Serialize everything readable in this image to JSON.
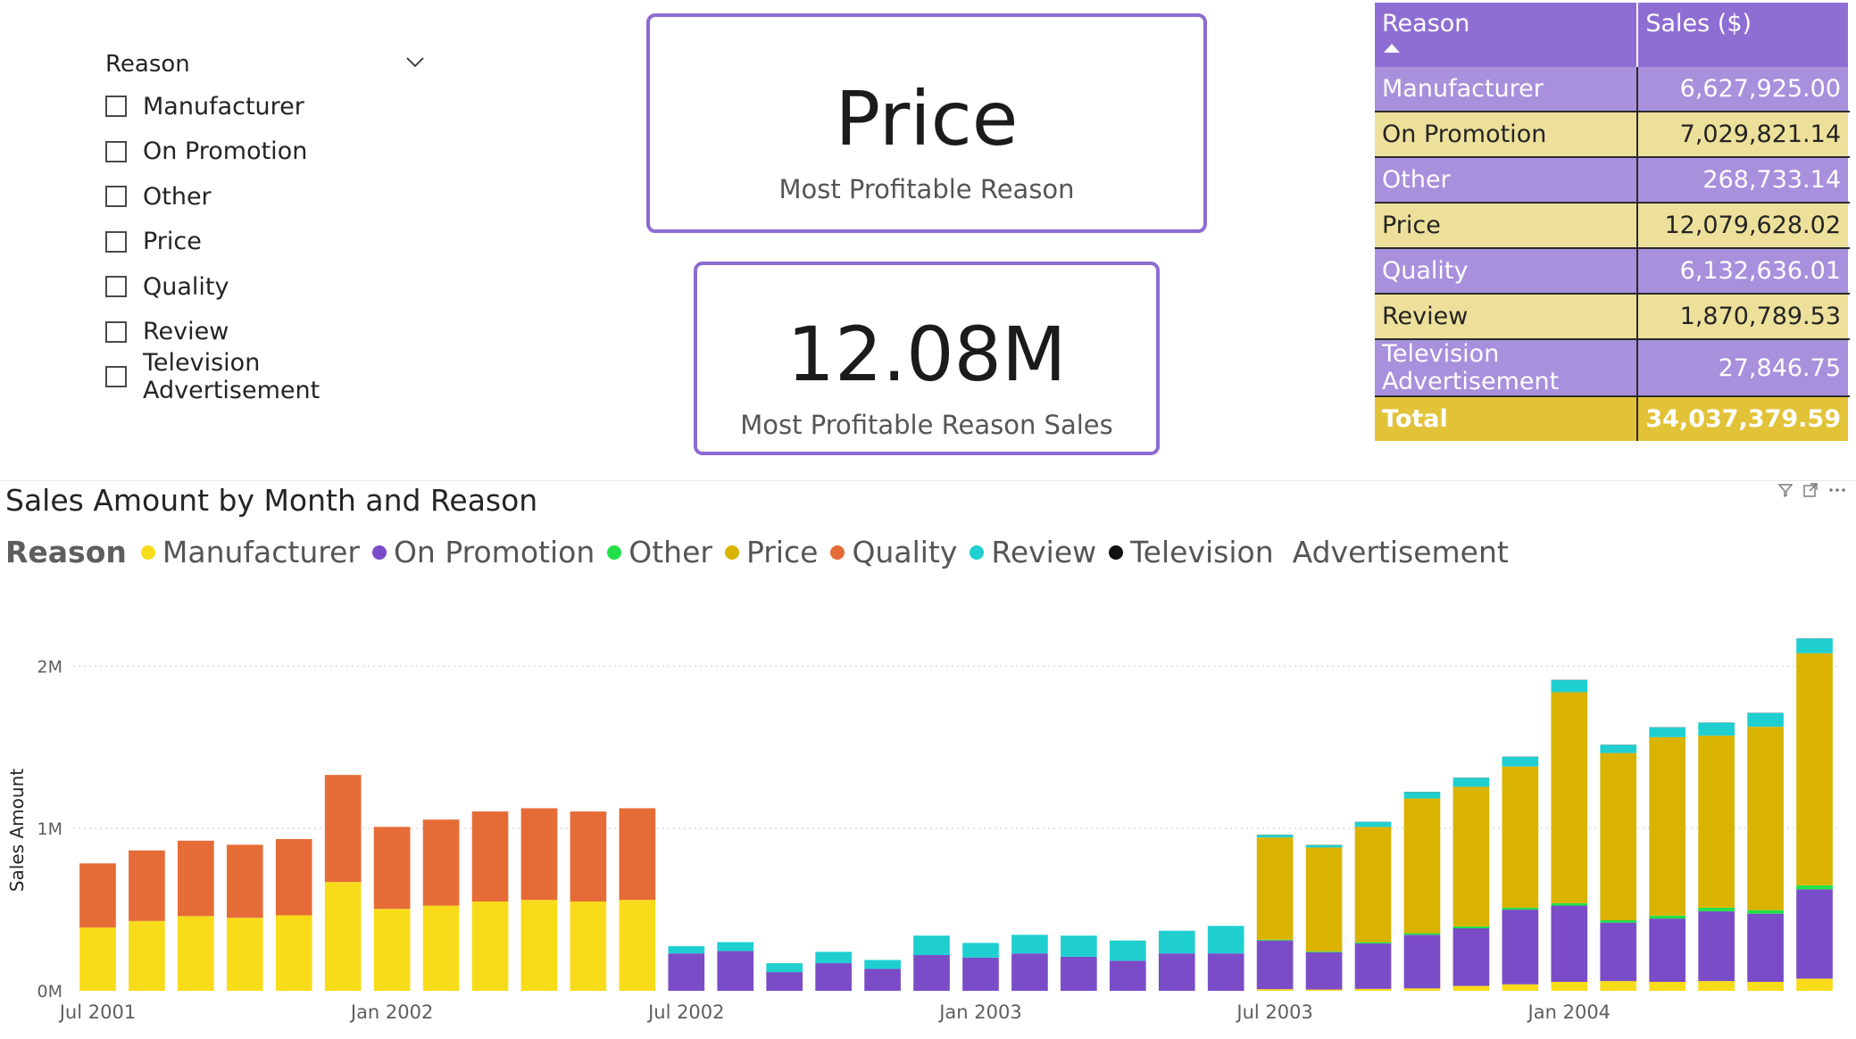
{
  "slicer": {
    "title": "Reason",
    "items": [
      "Manufacturer",
      "On Promotion",
      "Other",
      "Price",
      "Quality",
      "Review",
      "Television Advertisement"
    ],
    "icon": "chevron-down-icon"
  },
  "card_reason": {
    "value": "Price",
    "label": "Most Profitable Reason"
  },
  "card_sales": {
    "value": "12.08M",
    "label": "Most Profitable Reason Sales"
  },
  "table": {
    "headers": [
      "Reason",
      "Sales ($)"
    ],
    "rows": [
      {
        "reason": "Manufacturer",
        "sales": "6,627,925.00"
      },
      {
        "reason": "On Promotion",
        "sales": "7,029,821.14"
      },
      {
        "reason": "Other",
        "sales": "268,733.14"
      },
      {
        "reason": "Price",
        "sales": "12,079,628.02"
      },
      {
        "reason": "Quality",
        "sales": "6,132,636.01"
      },
      {
        "reason": "Review",
        "sales": "1,870,789.53"
      },
      {
        "reason": "Television Advertisement",
        "sales": "27,846.75"
      }
    ],
    "total": {
      "reason": "Total",
      "sales": "34,037,379.59"
    },
    "colors": {
      "header": "#8f6ed3",
      "row_purple": "#a890dd",
      "row_yellow": "#ede09b",
      "total": "#e2c338"
    }
  },
  "chart_header": {
    "title": "Sales Amount by Month and Reason",
    "icons": [
      "filter-icon",
      "focus-mode-icon",
      "more-options-icon"
    ]
  },
  "legend": {
    "title": "Reason",
    "items": [
      {
        "label": "Manufacturer",
        "color": "#f8dc1a"
      },
      {
        "label": "On Promotion",
        "color": "#7a4cc8"
      },
      {
        "label": "Other",
        "color": "#22e04a"
      },
      {
        "label": "Price",
        "color": "#d9b300"
      },
      {
        "label": "Quality",
        "color": "#e66c37"
      },
      {
        "label": "Review",
        "color": "#1fcfd0"
      },
      {
        "label": "Television  Advertisement",
        "color": "#111111"
      }
    ]
  },
  "chart_data": {
    "type": "bar",
    "stacked": true,
    "ylabel": "Sales Amount",
    "ylim": [
      0,
      2200000
    ],
    "y_ticks": [
      {
        "value": 0,
        "label": "0M"
      },
      {
        "value": 1000000,
        "label": "1M"
      },
      {
        "value": 2000000,
        "label": "2M"
      }
    ],
    "x_tick_labels": [
      {
        "index": 0,
        "label": "Jul 2001"
      },
      {
        "index": 6,
        "label": "Jan 2002"
      },
      {
        "index": 12,
        "label": "Jul 2002"
      },
      {
        "index": 18,
        "label": "Jan 2003"
      },
      {
        "index": 24,
        "label": "Jul 2003"
      },
      {
        "index": 30,
        "label": "Jan 2004"
      }
    ],
    "categories": [
      "Jul 2001",
      "Aug 2001",
      "Sep 2001",
      "Oct 2001",
      "Nov 2001",
      "Dec 2001",
      "Jan 2002",
      "Feb 2002",
      "Mar 2002",
      "Apr 2002",
      "May 2002",
      "Jun 2002",
      "Jul 2002",
      "Aug 2002",
      "Sep 2002",
      "Oct 2002",
      "Nov 2002",
      "Dec 2002",
      "Jan 2003",
      "Feb 2003",
      "Mar 2003",
      "Apr 2003",
      "May 2003",
      "Jun 2003",
      "Jul 2003",
      "Aug 2003",
      "Sep 2003",
      "Oct 2003",
      "Nov 2003",
      "Dec 2003",
      "Jan 2004",
      "Feb 2004",
      "Mar 2004",
      "Apr 2004",
      "May 2004",
      "Jun 2004"
    ],
    "grid": true,
    "legend_position": "top-left",
    "series": [
      {
        "name": "Manufacturer",
        "color": "#f8dc1a",
        "values": [
          390000,
          430000,
          460000,
          450000,
          465000,
          670000,
          505000,
          525000,
          550000,
          560000,
          550000,
          560000,
          0,
          0,
          0,
          0,
          0,
          0,
          0,
          0,
          0,
          0,
          0,
          0,
          10000,
          8000,
          12000,
          15000,
          30000,
          40000,
          55000,
          60000,
          55000,
          60000,
          55000,
          75000
        ]
      },
      {
        "name": "On Promotion",
        "color": "#7a4cc8",
        "values": [
          0,
          0,
          0,
          0,
          0,
          0,
          0,
          0,
          0,
          0,
          0,
          0,
          230000,
          245000,
          115000,
          170000,
          135000,
          220000,
          205000,
          230000,
          210000,
          185000,
          230000,
          230000,
          300000,
          230000,
          280000,
          330000,
          355000,
          460000,
          470000,
          360000,
          390000,
          430000,
          420000,
          550000
        ]
      },
      {
        "name": "Other",
        "color": "#22e04a",
        "values": [
          0,
          0,
          0,
          0,
          0,
          0,
          0,
          0,
          0,
          0,
          0,
          0,
          0,
          0,
          0,
          0,
          0,
          0,
          0,
          0,
          0,
          0,
          0,
          0,
          5000,
          5000,
          8000,
          10000,
          12000,
          12000,
          15000,
          15000,
          18000,
          22000,
          22000,
          25000
        ]
      },
      {
        "name": "Price",
        "color": "#d9b300",
        "values": [
          0,
          0,
          0,
          0,
          0,
          0,
          0,
          0,
          0,
          0,
          0,
          0,
          0,
          0,
          0,
          0,
          0,
          0,
          0,
          0,
          0,
          0,
          0,
          0,
          630000,
          640000,
          710000,
          830000,
          860000,
          870000,
          1300000,
          1030000,
          1100000,
          1060000,
          1130000,
          1430000
        ]
      },
      {
        "name": "Quality",
        "color": "#e66c37",
        "values": [
          395000,
          435000,
          465000,
          450000,
          470000,
          660000,
          505000,
          530000,
          555000,
          565000,
          555000,
          565000,
          0,
          0,
          0,
          0,
          0,
          0,
          0,
          0,
          0,
          0,
          0,
          0,
          0,
          0,
          0,
          0,
          0,
          0,
          0,
          0,
          0,
          0,
          0,
          0
        ]
      },
      {
        "name": "Review",
        "color": "#1fcfd0",
        "values": [
          0,
          0,
          0,
          0,
          0,
          0,
          0,
          0,
          0,
          0,
          0,
          0,
          45000,
          55000,
          55000,
          70000,
          55000,
          120000,
          90000,
          115000,
          130000,
          125000,
          140000,
          170000,
          15000,
          15000,
          30000,
          40000,
          55000,
          60000,
          75000,
          50000,
          60000,
          80000,
          85000,
          90000
        ]
      },
      {
        "name": "Television Advertisement",
        "color": "#111111",
        "values": [
          0,
          0,
          0,
          0,
          0,
          0,
          0,
          0,
          0,
          0,
          0,
          0,
          0,
          0,
          0,
          0,
          0,
          0,
          0,
          0,
          0,
          0,
          0,
          0,
          1000,
          1000,
          1000,
          1000,
          1000,
          1000,
          1000,
          1000,
          1000,
          1000,
          1000,
          1000
        ]
      }
    ]
  }
}
